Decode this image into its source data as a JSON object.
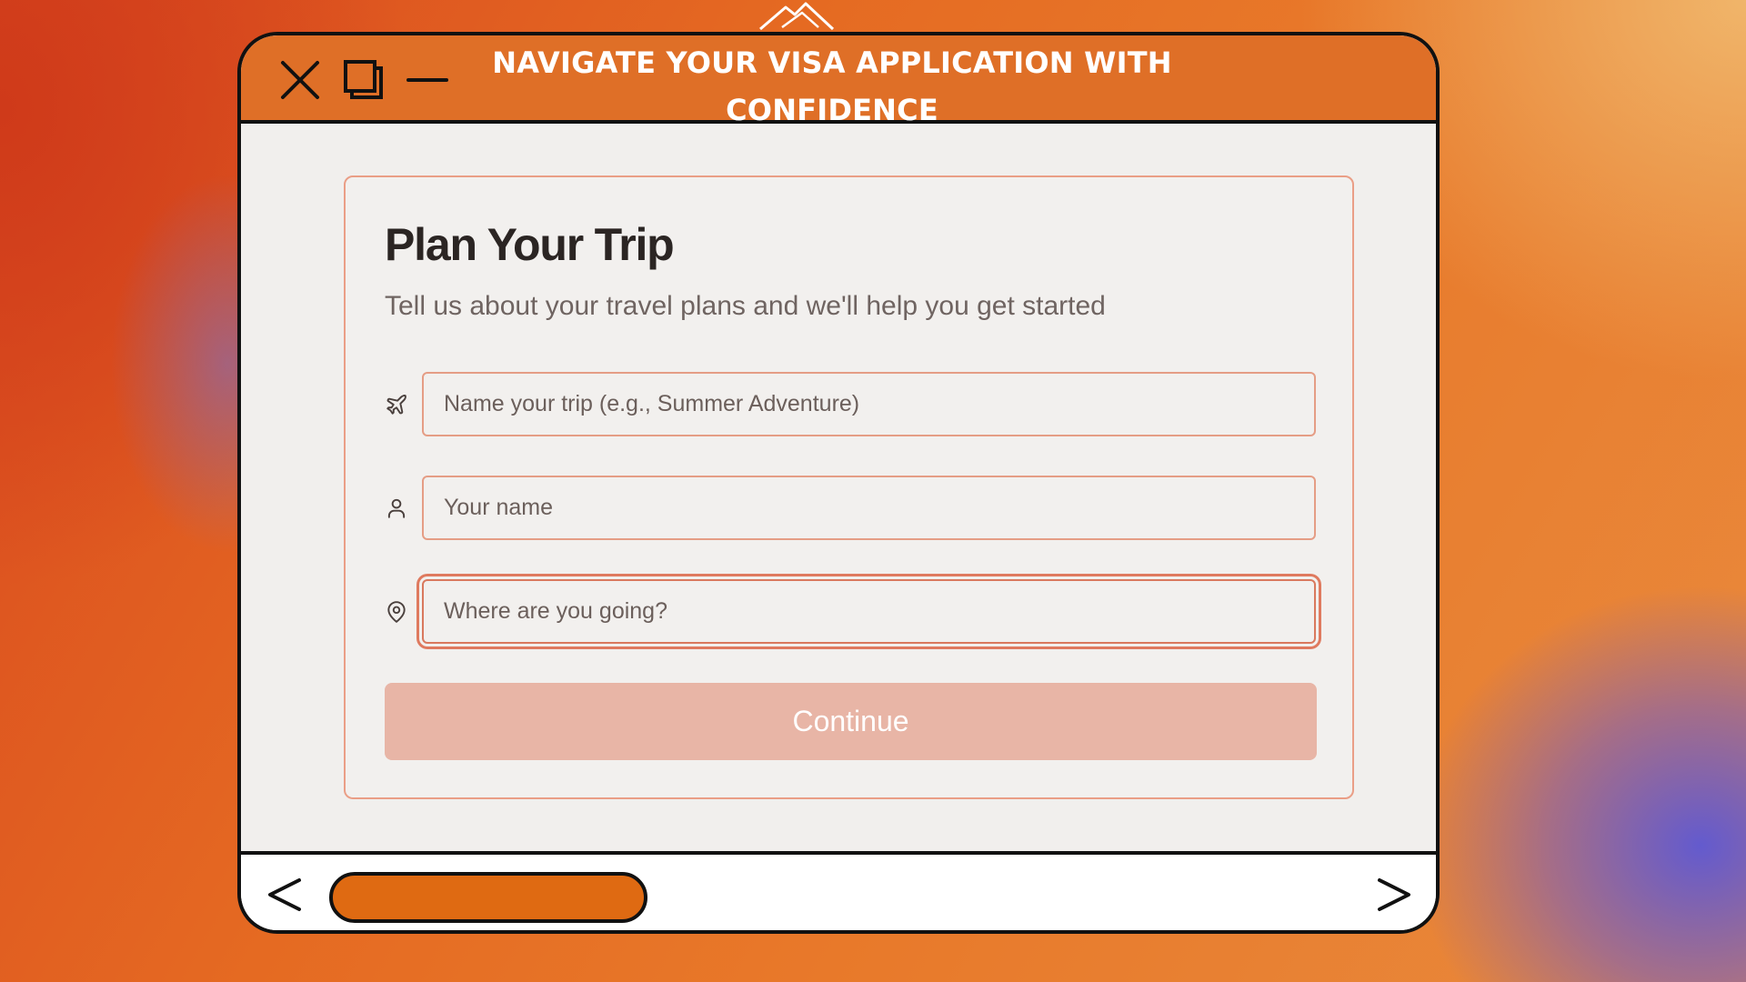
{
  "window": {
    "title": "NAVIGATE YOUR VISA APPLICATION WITH CONFIDENCE",
    "controls": {
      "close_icon": "close-icon",
      "maximize_icon": "maximize-icon",
      "minimize_icon": "minimize-icon"
    }
  },
  "form": {
    "title": "Plan Your Trip",
    "subtitle": "Tell us about your travel plans and we'll help you get started",
    "fields": [
      {
        "icon": "plane-icon",
        "placeholder": "Name your trip (e.g., Summer Adventure)",
        "value": ""
      },
      {
        "icon": "user-icon",
        "placeholder": "Your name",
        "value": ""
      },
      {
        "icon": "map-pin-icon",
        "placeholder": "Where are you going?",
        "value": "",
        "focused": true
      }
    ],
    "continue_label": "Continue"
  },
  "footer": {
    "prev_icon": "chevron-left-icon",
    "next_icon": "chevron-right-icon"
  },
  "colors": {
    "titlebar": "#df6f27",
    "accent_border": "#e59d85",
    "button_disabled": "#e8b5a6",
    "scroll_pill": "#df6a12"
  }
}
